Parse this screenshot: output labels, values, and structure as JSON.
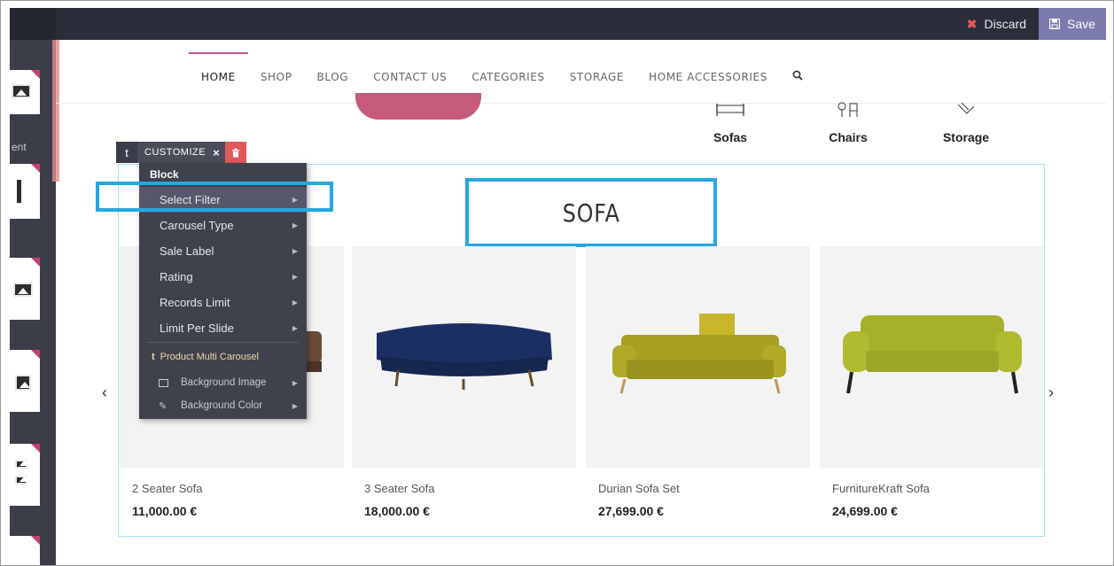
{
  "editor": {
    "discard_label": "Discard",
    "save_label": "Save",
    "discard_icon": "close-icon",
    "save_icon": "floppy-disk-icon"
  },
  "left_panel": {
    "partial_label": "ent"
  },
  "nav": {
    "items": [
      {
        "label": "HOME",
        "active": true
      },
      {
        "label": "SHOP"
      },
      {
        "label": "BLOG"
      },
      {
        "label": "CONTACT US"
      },
      {
        "label": "CATEGORIES"
      },
      {
        "label": "STORAGE"
      },
      {
        "label": "HOME ACCESSORIES"
      }
    ],
    "search_icon": "search-icon"
  },
  "categories": [
    {
      "label": "Sofas",
      "icon": "sofa-icon"
    },
    {
      "label": "Chairs",
      "icon": "chair-icon"
    },
    {
      "label": "Storage",
      "icon": "storage-icon"
    }
  ],
  "section": {
    "title": "SOFA"
  },
  "products": [
    {
      "name": "2 Seater Sofa",
      "price": "11,000.00 €"
    },
    {
      "name": "3 Seater Sofa",
      "price": "18,000.00 €"
    },
    {
      "name": "Durian Sofa Set",
      "price": "27,699.00 €"
    },
    {
      "name": "FurnitureKraft Sofa",
      "price": "24,699.00 €"
    }
  ],
  "customize": {
    "t_label": "t",
    "label": "CUSTOMIZE",
    "close": "×",
    "delete_icon": "trash-icon",
    "menu_heading": "Block",
    "menu_items": [
      {
        "label": "Select Filter",
        "selected": true
      },
      {
        "label": "Carousel Type"
      },
      {
        "label": "Sale Label"
      },
      {
        "label": "Rating"
      },
      {
        "label": "Records Limit"
      },
      {
        "label": "Limit Per Slide"
      }
    ],
    "sub_heading": "Product Multi Carousel",
    "options": [
      {
        "label": "Background Image",
        "icon": "image-icon"
      },
      {
        "label": "Background Color",
        "icon": "eyedropper-icon"
      }
    ]
  },
  "colors": {
    "accent": "#c65b7c",
    "highlight": "#26a7e0",
    "editor_bar": "#2b2d3a",
    "save_button": "#7c7bad"
  }
}
